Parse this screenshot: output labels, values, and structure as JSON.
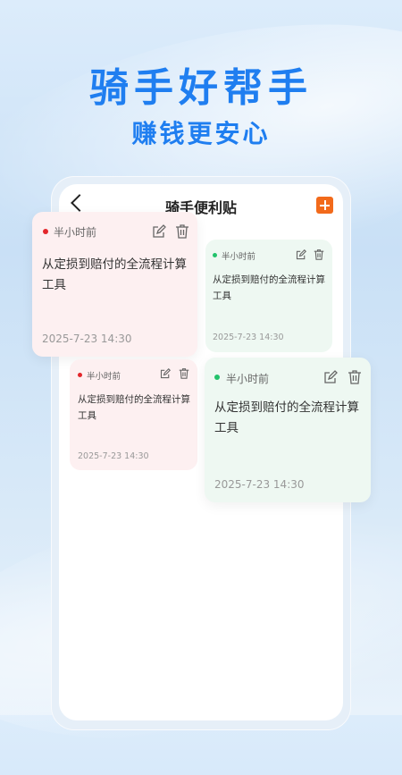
{
  "hero": {
    "title": "骑手好帮手",
    "subtitle": "赚钱更安心"
  },
  "header": {
    "title": "骑手便利贴",
    "back_icon": "chevron-left-icon",
    "add_icon": "plus-icon"
  },
  "colors": {
    "accent_blue": "#1f7ef0",
    "add_orange": "#f26a1b",
    "pink_card": "#fdf0f1",
    "green_card": "#eef8f2",
    "red_dot": "#e3262b",
    "green_dot": "#22c26b"
  },
  "notes": [
    {
      "time": "半小时前",
      "text": "从定损到赔付的全流程计算工具",
      "date": "2025-7-23 14:30",
      "status": "red"
    },
    {
      "time": "半小时前",
      "text": "从定损到赔付的全流程计算工具",
      "date": "2025-7-23 14:30",
      "status": "green"
    },
    {
      "time": "半小时前",
      "text": "从定损到赔付的全流程计算工具",
      "date": "2025-7-23 14:30",
      "status": "red"
    },
    {
      "time": "半小时前",
      "text": "从定损到赔付的全流程计算工具",
      "date": "2025-7-23 14:30",
      "status": "green"
    }
  ]
}
